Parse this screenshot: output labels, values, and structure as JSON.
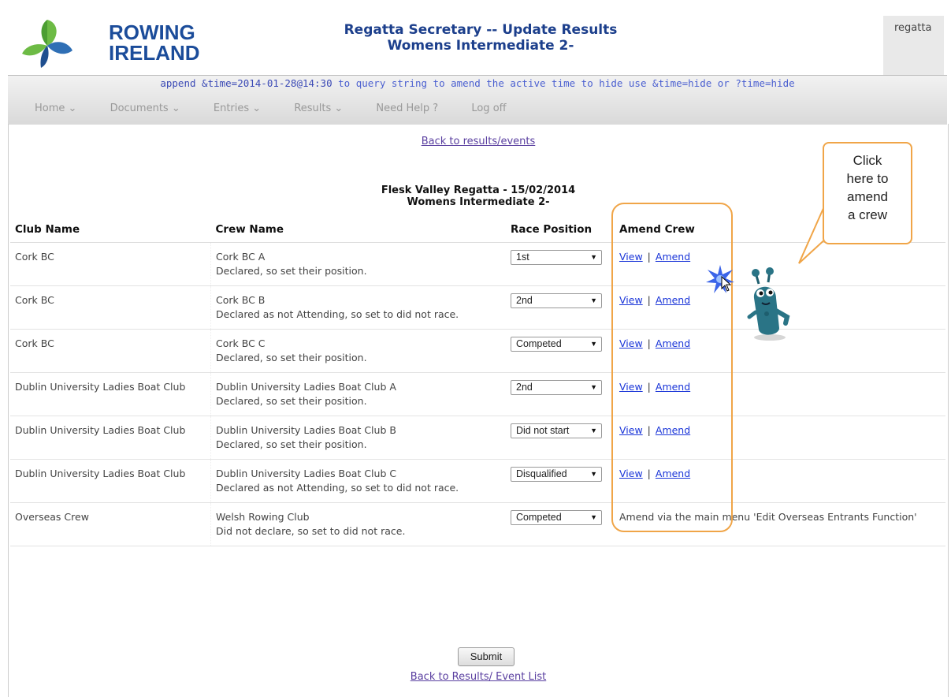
{
  "header": {
    "brand_line1": "ROWING",
    "brand_line2": "IRELAND",
    "title_line1": "Regatta Secretary -- Update Results",
    "title_line2": "Womens Intermediate 2-",
    "user": "regatta"
  },
  "notice": {
    "code1": "append &time=2014-01-28@14:30",
    "text1": " to query string to amend the active time to hide use ",
    "code2": "&time=hide or ?time=hide"
  },
  "menu": [
    "Home ⌄",
    "Documents ⌄",
    "Entries ⌄",
    "Results ⌄",
    "Need Help ?",
    "Log off"
  ],
  "content": {
    "back_top": "Back to results/events",
    "event_line1": "Flesk Valley Regatta - 15/02/2014",
    "event_line2": "Womens Intermediate 2-",
    "columns": [
      "Club Name",
      "Crew Name",
      "Race Position",
      "Amend Crew"
    ],
    "rows": [
      {
        "club": "Cork BC",
        "crew": "Cork BC A",
        "note": "Declared, so set their position.",
        "position": "1st",
        "view": "View",
        "amend": "Amend"
      },
      {
        "club": "Cork BC",
        "crew": "Cork BC B",
        "note": "Declared as not Attending, so set to did not race.",
        "position": "2nd",
        "view": "View",
        "amend": "Amend"
      },
      {
        "club": "Cork BC",
        "crew": "Cork BC C",
        "note": "Declared, so set their position.",
        "position": "Competed",
        "view": "View",
        "amend": "Amend"
      },
      {
        "club": "Dublin University Ladies Boat Club",
        "crew": "Dublin University Ladies Boat Club A",
        "note": "Declared, so set their position.",
        "position": "2nd",
        "view": "View",
        "amend": "Amend"
      },
      {
        "club": "Dublin University Ladies Boat Club",
        "crew": "Dublin University Ladies Boat Club B",
        "note": "Declared, so set their position.",
        "position": "Did not start",
        "view": "View",
        "amend": "Amend"
      },
      {
        "club": "Dublin University Ladies Boat Club",
        "crew": "Dublin University Ladies Boat Club C",
        "note": "Declared as not Attending, so set to did not race.",
        "position": "Disqualified",
        "view": "View",
        "amend": "Amend"
      },
      {
        "club": "Overseas Crew",
        "crew": "Welsh Rowing Club",
        "note": "Did not declare, so set to did not race.",
        "position": "Competed",
        "amend_text": "Amend via the main menu 'Edit Overseas Entrants Function'"
      }
    ],
    "submit": "Submit",
    "back_bottom": "Back to Results/ Event List"
  },
  "callout": {
    "lines": [
      "Click",
      "here to",
      "amend",
      "a crew"
    ]
  },
  "colors": {
    "brand": "#1b4c9a",
    "accent": "#f0a548",
    "link": "#1a35d8"
  }
}
